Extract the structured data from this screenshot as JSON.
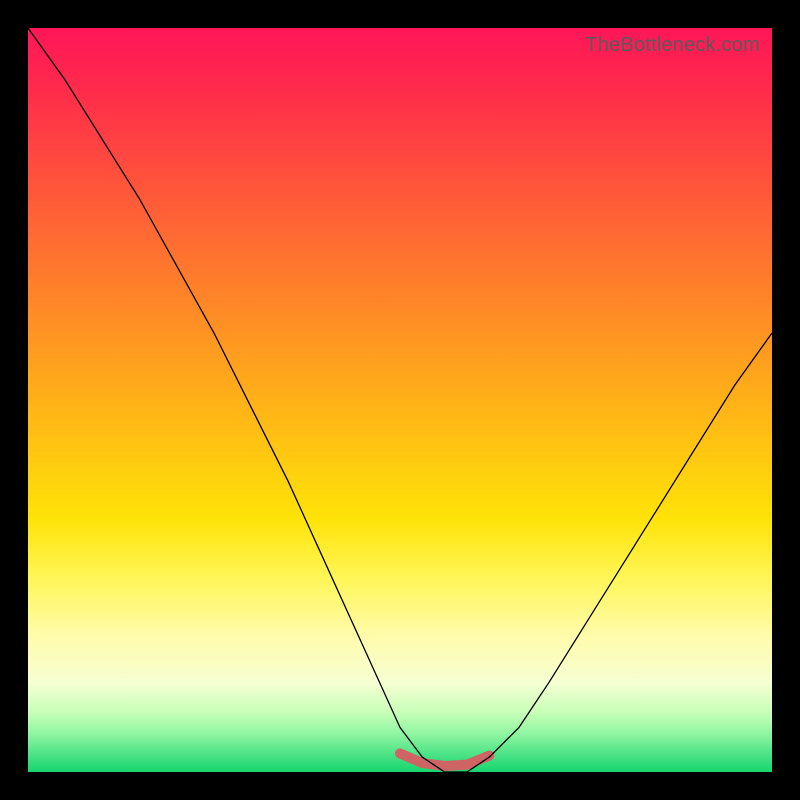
{
  "watermark": "TheBottleneck.com",
  "colors": {
    "frame": "#000000",
    "gradient_top": "#ff1658",
    "gradient_mid": "#ffe308",
    "gradient_bottom": "#16d66e",
    "curve": "#000000",
    "marker": "#cf6464"
  },
  "chart_data": {
    "type": "line",
    "title": "",
    "xlabel": "",
    "ylabel": "",
    "notes": "Axes unlabeled; values are normalized 0–1 along each axis. Curve is a V-shaped bottleneck profile with minimum near x≈0.55 reaching y≈0; y≈1 at x=0 and y≈0.59 at x=1. A short salmon marker band highlights the flat bottom between x≈0.50 and x≈0.62.",
    "xlim": [
      0,
      1
    ],
    "ylim": [
      0,
      1
    ],
    "series": [
      {
        "name": "bottleneck-curve",
        "x": [
          0.0,
          0.05,
          0.1,
          0.15,
          0.2,
          0.25,
          0.3,
          0.35,
          0.4,
          0.45,
          0.5,
          0.53,
          0.56,
          0.59,
          0.62,
          0.66,
          0.7,
          0.75,
          0.8,
          0.85,
          0.9,
          0.95,
          1.0
        ],
        "y": [
          1.0,
          0.93,
          0.85,
          0.77,
          0.68,
          0.59,
          0.49,
          0.39,
          0.28,
          0.17,
          0.06,
          0.02,
          0.0,
          0.0,
          0.02,
          0.06,
          0.12,
          0.2,
          0.28,
          0.36,
          0.44,
          0.52,
          0.59
        ]
      }
    ],
    "marker_band": {
      "x": [
        0.5,
        0.53,
        0.56,
        0.59,
        0.62
      ],
      "y": [
        0.025,
        0.012,
        0.008,
        0.01,
        0.022
      ]
    }
  }
}
